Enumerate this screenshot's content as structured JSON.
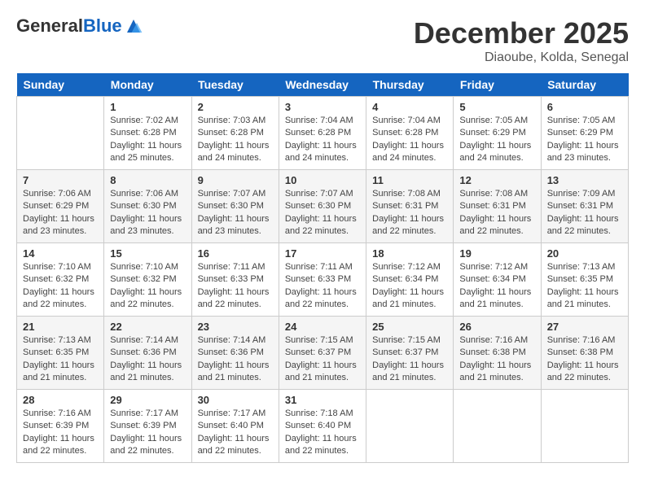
{
  "header": {
    "logo_general": "General",
    "logo_blue": "Blue",
    "month_title": "December 2025",
    "location": "Diaoube, Kolda, Senegal"
  },
  "days_of_week": [
    "Sunday",
    "Monday",
    "Tuesday",
    "Wednesday",
    "Thursday",
    "Friday",
    "Saturday"
  ],
  "weeks": [
    [
      {
        "day": "",
        "sunrise": "",
        "sunset": "",
        "daylight": ""
      },
      {
        "day": "1",
        "sunrise": "Sunrise: 7:02 AM",
        "sunset": "Sunset: 6:28 PM",
        "daylight": "Daylight: 11 hours and 25 minutes."
      },
      {
        "day": "2",
        "sunrise": "Sunrise: 7:03 AM",
        "sunset": "Sunset: 6:28 PM",
        "daylight": "Daylight: 11 hours and 24 minutes."
      },
      {
        "day": "3",
        "sunrise": "Sunrise: 7:04 AM",
        "sunset": "Sunset: 6:28 PM",
        "daylight": "Daylight: 11 hours and 24 minutes."
      },
      {
        "day": "4",
        "sunrise": "Sunrise: 7:04 AM",
        "sunset": "Sunset: 6:28 PM",
        "daylight": "Daylight: 11 hours and 24 minutes."
      },
      {
        "day": "5",
        "sunrise": "Sunrise: 7:05 AM",
        "sunset": "Sunset: 6:29 PM",
        "daylight": "Daylight: 11 hours and 24 minutes."
      },
      {
        "day": "6",
        "sunrise": "Sunrise: 7:05 AM",
        "sunset": "Sunset: 6:29 PM",
        "daylight": "Daylight: 11 hours and 23 minutes."
      }
    ],
    [
      {
        "day": "7",
        "sunrise": "Sunrise: 7:06 AM",
        "sunset": "Sunset: 6:29 PM",
        "daylight": "Daylight: 11 hours and 23 minutes."
      },
      {
        "day": "8",
        "sunrise": "Sunrise: 7:06 AM",
        "sunset": "Sunset: 6:30 PM",
        "daylight": "Daylight: 11 hours and 23 minutes."
      },
      {
        "day": "9",
        "sunrise": "Sunrise: 7:07 AM",
        "sunset": "Sunset: 6:30 PM",
        "daylight": "Daylight: 11 hours and 23 minutes."
      },
      {
        "day": "10",
        "sunrise": "Sunrise: 7:07 AM",
        "sunset": "Sunset: 6:30 PM",
        "daylight": "Daylight: 11 hours and 22 minutes."
      },
      {
        "day": "11",
        "sunrise": "Sunrise: 7:08 AM",
        "sunset": "Sunset: 6:31 PM",
        "daylight": "Daylight: 11 hours and 22 minutes."
      },
      {
        "day": "12",
        "sunrise": "Sunrise: 7:08 AM",
        "sunset": "Sunset: 6:31 PM",
        "daylight": "Daylight: 11 hours and 22 minutes."
      },
      {
        "day": "13",
        "sunrise": "Sunrise: 7:09 AM",
        "sunset": "Sunset: 6:31 PM",
        "daylight": "Daylight: 11 hours and 22 minutes."
      }
    ],
    [
      {
        "day": "14",
        "sunrise": "Sunrise: 7:10 AM",
        "sunset": "Sunset: 6:32 PM",
        "daylight": "Daylight: 11 hours and 22 minutes."
      },
      {
        "day": "15",
        "sunrise": "Sunrise: 7:10 AM",
        "sunset": "Sunset: 6:32 PM",
        "daylight": "Daylight: 11 hours and 22 minutes."
      },
      {
        "day": "16",
        "sunrise": "Sunrise: 7:11 AM",
        "sunset": "Sunset: 6:33 PM",
        "daylight": "Daylight: 11 hours and 22 minutes."
      },
      {
        "day": "17",
        "sunrise": "Sunrise: 7:11 AM",
        "sunset": "Sunset: 6:33 PM",
        "daylight": "Daylight: 11 hours and 22 minutes."
      },
      {
        "day": "18",
        "sunrise": "Sunrise: 7:12 AM",
        "sunset": "Sunset: 6:34 PM",
        "daylight": "Daylight: 11 hours and 21 minutes."
      },
      {
        "day": "19",
        "sunrise": "Sunrise: 7:12 AM",
        "sunset": "Sunset: 6:34 PM",
        "daylight": "Daylight: 11 hours and 21 minutes."
      },
      {
        "day": "20",
        "sunrise": "Sunrise: 7:13 AM",
        "sunset": "Sunset: 6:35 PM",
        "daylight": "Daylight: 11 hours and 21 minutes."
      }
    ],
    [
      {
        "day": "21",
        "sunrise": "Sunrise: 7:13 AM",
        "sunset": "Sunset: 6:35 PM",
        "daylight": "Daylight: 11 hours and 21 minutes."
      },
      {
        "day": "22",
        "sunrise": "Sunrise: 7:14 AM",
        "sunset": "Sunset: 6:36 PM",
        "daylight": "Daylight: 11 hours and 21 minutes."
      },
      {
        "day": "23",
        "sunrise": "Sunrise: 7:14 AM",
        "sunset": "Sunset: 6:36 PM",
        "daylight": "Daylight: 11 hours and 21 minutes."
      },
      {
        "day": "24",
        "sunrise": "Sunrise: 7:15 AM",
        "sunset": "Sunset: 6:37 PM",
        "daylight": "Daylight: 11 hours and 21 minutes."
      },
      {
        "day": "25",
        "sunrise": "Sunrise: 7:15 AM",
        "sunset": "Sunset: 6:37 PM",
        "daylight": "Daylight: 11 hours and 21 minutes."
      },
      {
        "day": "26",
        "sunrise": "Sunrise: 7:16 AM",
        "sunset": "Sunset: 6:38 PM",
        "daylight": "Daylight: 11 hours and 21 minutes."
      },
      {
        "day": "27",
        "sunrise": "Sunrise: 7:16 AM",
        "sunset": "Sunset: 6:38 PM",
        "daylight": "Daylight: 11 hours and 22 minutes."
      }
    ],
    [
      {
        "day": "28",
        "sunrise": "Sunrise: 7:16 AM",
        "sunset": "Sunset: 6:39 PM",
        "daylight": "Daylight: 11 hours and 22 minutes."
      },
      {
        "day": "29",
        "sunrise": "Sunrise: 7:17 AM",
        "sunset": "Sunset: 6:39 PM",
        "daylight": "Daylight: 11 hours and 22 minutes."
      },
      {
        "day": "30",
        "sunrise": "Sunrise: 7:17 AM",
        "sunset": "Sunset: 6:40 PM",
        "daylight": "Daylight: 11 hours and 22 minutes."
      },
      {
        "day": "31",
        "sunrise": "Sunrise: 7:18 AM",
        "sunset": "Sunset: 6:40 PM",
        "daylight": "Daylight: 11 hours and 22 minutes."
      },
      {
        "day": "",
        "sunrise": "",
        "sunset": "",
        "daylight": ""
      },
      {
        "day": "",
        "sunrise": "",
        "sunset": "",
        "daylight": ""
      },
      {
        "day": "",
        "sunrise": "",
        "sunset": "",
        "daylight": ""
      }
    ]
  ]
}
